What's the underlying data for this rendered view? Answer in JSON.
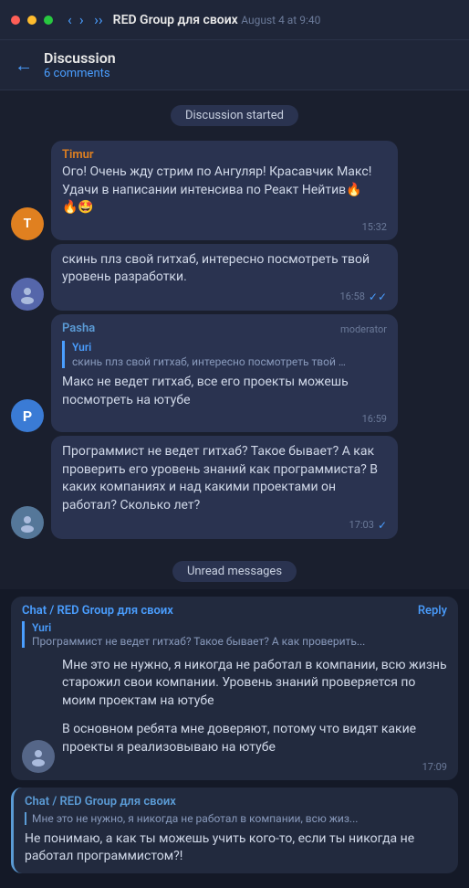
{
  "topbar": {
    "channel": "RED Group для своих",
    "time": "August 4 at 9:40"
  },
  "header": {
    "title": "Discussion",
    "subtitle": "6 comments"
  },
  "discussion_started_label": "Discussion started",
  "messages": [
    {
      "id": "msg1",
      "sender": "Timur",
      "sender_color": "timur",
      "text": "Ого! Очень жду стрим по Ангуляр! Красавчик Макс! Удачи в написании интенсива по Реакт Нейтив🔥",
      "emoji_extra": "🔥🤩",
      "time": "15:32",
      "checked": false,
      "avatar_letter": "T",
      "avatar_class": "av-timur"
    },
    {
      "id": "msg2",
      "sender": null,
      "text": "скинь плз свой гитхаб, интересно посмотреть твой уровень разработки.",
      "time": "16:58",
      "checked": true,
      "double_check": true,
      "avatar_class": "av-anon"
    },
    {
      "id": "msg3",
      "sender": "Pasha",
      "sender_color": "pasha",
      "moderator": true,
      "quote_author": "Yuri",
      "quote_text": "скинь плз свой гитхаб, интересно посмотреть твой уровень ...",
      "text": "Макс не ведет гитхаб, все его проекты можешь посмотреть на ютубе",
      "time": "16:59",
      "checked": false,
      "avatar_letter": "P",
      "avatar_class": "av-pasha"
    },
    {
      "id": "msg4",
      "sender": null,
      "text": "Программист не ведет гитхаб? Такое бывает? А как проверить его уровень знаний как программиста? В каких компаниях и над какими проектами он работал? Сколько лет?",
      "time": "17:03",
      "checked": true,
      "avatar_class": "av-user2"
    }
  ],
  "unread_label": "Unread messages",
  "reply_section": {
    "channel": "Chat / RED Group для своих",
    "reply_label": "Reply",
    "quote_author": "Yuri",
    "quote_text": "Программист не ведет гитхаб? Такое бывает? А как проверить...",
    "message_text1": "Мне это не нужно, я никогда не работал в компании, всю жизнь старожил свои компании. Уровень знаний проверяется по моим проектам на ютубе",
    "message_text2": "В основном ребята мне доверяют, потому что видят какие проекты я реализовываю на ютубе",
    "time": "17:09",
    "avatar_class": "av-reply-user"
  },
  "nested_reply": {
    "channel": "Chat / RED Group для своих",
    "quote_text": "Мне это не нужно, я никогда не работал в компании, всю жиз...",
    "text": "Не понимаю, а как ты можешь учить кого-то, если ты никогда не работал программистом?!"
  }
}
